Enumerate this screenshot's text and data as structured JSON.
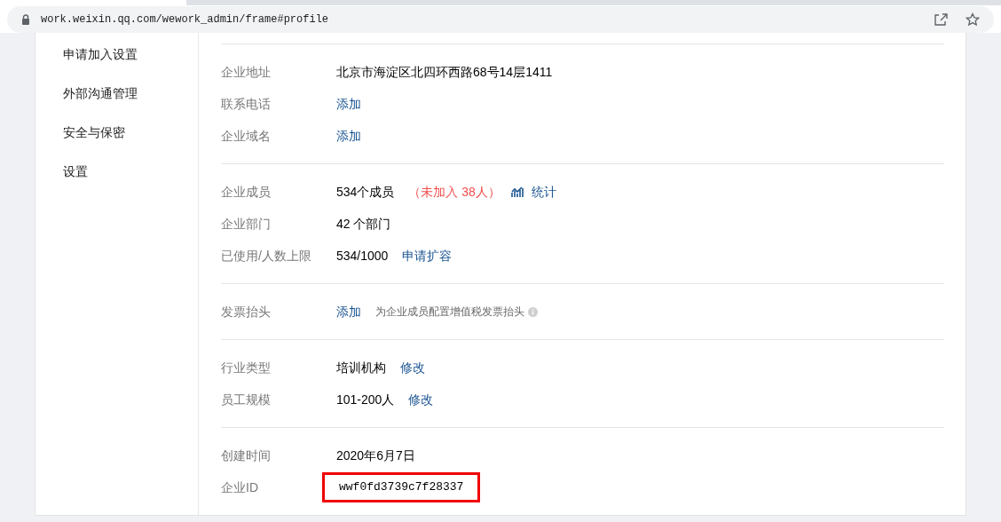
{
  "address_bar": {
    "url": "work.weixin.qq.com/wework_admin/frame#profile"
  },
  "sidebar": {
    "items": [
      {
        "label": "申请加入设置"
      },
      {
        "label": "外部沟通管理"
      },
      {
        "label": "安全与保密"
      },
      {
        "label": "设置"
      }
    ]
  },
  "sections": [
    {
      "rows": [
        {
          "label": "企业地址",
          "values": [
            {
              "kind": "text",
              "text": "北京市海淀区北四环西路68号14层1411"
            }
          ]
        },
        {
          "label": "联系电话",
          "values": [
            {
              "kind": "link",
              "text": "添加"
            }
          ]
        },
        {
          "label": "企业域名",
          "values": [
            {
              "kind": "link",
              "text": "添加"
            }
          ]
        }
      ]
    },
    {
      "rows": [
        {
          "label": "企业成员",
          "values": [
            {
              "kind": "text",
              "text": "534个成员"
            },
            {
              "kind": "alert",
              "text": "（未加入 38人）"
            },
            {
              "kind": "stats_link",
              "text": "统计"
            }
          ]
        },
        {
          "label": "企业部门",
          "values": [
            {
              "kind": "text",
              "text": "42 个部门"
            }
          ]
        },
        {
          "label": "已使用/人数上限",
          "values": [
            {
              "kind": "text",
              "text": "534/1000"
            },
            {
              "kind": "link",
              "text": "申请扩容"
            }
          ]
        }
      ]
    },
    {
      "rows": [
        {
          "label": "发票抬头",
          "values": [
            {
              "kind": "link",
              "text": "添加"
            },
            {
              "kind": "hint",
              "text": "为企业成员配置增值税发票抬头"
            }
          ]
        }
      ]
    },
    {
      "rows": [
        {
          "label": "行业类型",
          "values": [
            {
              "kind": "text",
              "text": "培训机构"
            },
            {
              "kind": "link",
              "text": "修改"
            }
          ]
        },
        {
          "label": "员工规模",
          "values": [
            {
              "kind": "text",
              "text": "101-200人"
            },
            {
              "kind": "link",
              "text": "修改"
            }
          ]
        }
      ]
    },
    {
      "rows": [
        {
          "label": "创建时间",
          "values": [
            {
              "kind": "text",
              "text": "2020年6月7日"
            }
          ]
        },
        {
          "label": "企业ID",
          "values": [
            {
              "kind": "boxed",
              "text": "wwf0fd3739c7f28337"
            }
          ]
        }
      ]
    }
  ]
}
